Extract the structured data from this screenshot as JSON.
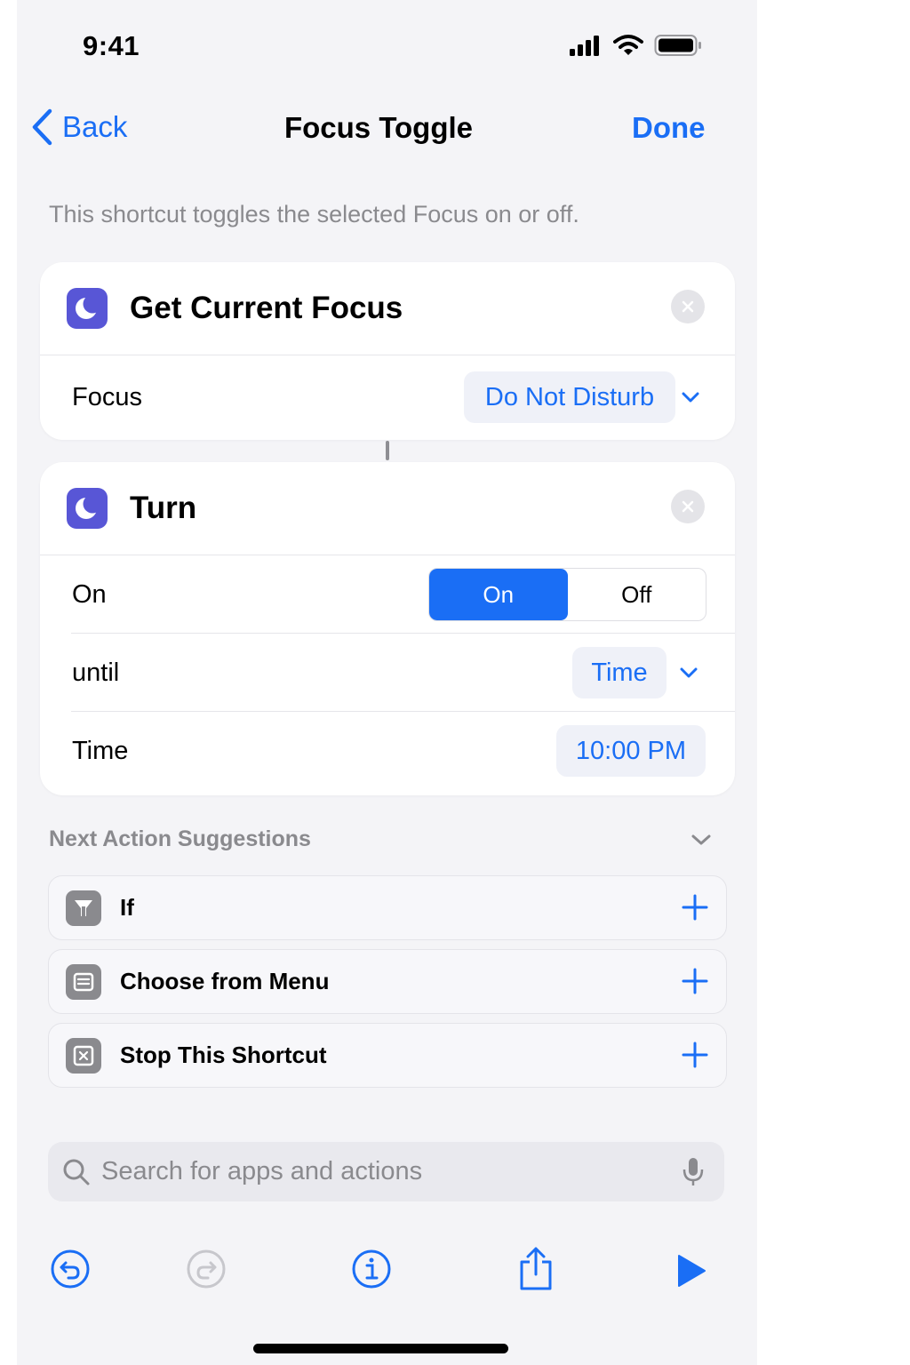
{
  "status_bar": {
    "time": "9:41"
  },
  "nav": {
    "back_label": "Back",
    "title": "Focus Toggle",
    "done_label": "Done"
  },
  "description": "This shortcut toggles the selected Focus on or off.",
  "get_focus_action": {
    "title": "Get Current Focus",
    "icon": "moon-icon",
    "focus_label": "Focus",
    "focus_value": "Do Not Disturb"
  },
  "turn_action": {
    "title": "Turn",
    "icon": "moon-icon",
    "state_label": "On",
    "segment_on": "On",
    "segment_off": "Off",
    "selected_segment": "On",
    "until_label": "until",
    "until_value": "Time",
    "time_label": "Time",
    "time_value": "10:00 PM"
  },
  "suggestions": {
    "header": "Next Action Suggestions",
    "items": [
      {
        "label": "If",
        "icon": "branch-icon"
      },
      {
        "label": "Choose from Menu",
        "icon": "menu-icon"
      },
      {
        "label": "Stop This Shortcut",
        "icon": "stop-icon"
      }
    ]
  },
  "search": {
    "placeholder": "Search for apps and actions"
  },
  "colors": {
    "accent": "#1a6ef5",
    "action_icon": "#5856d6",
    "background": "#f4f4f7"
  }
}
